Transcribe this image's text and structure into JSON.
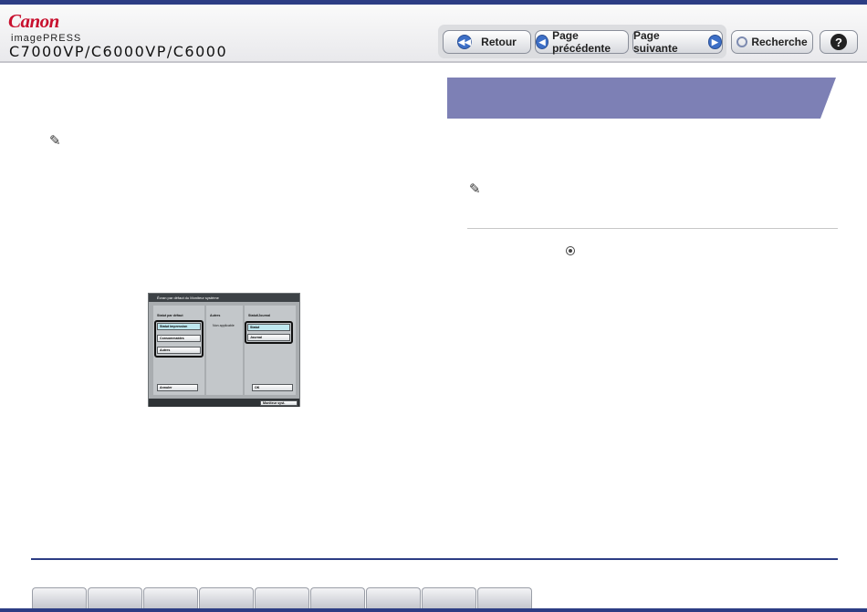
{
  "header": {
    "brand": "Canon",
    "sub_brand": "imagePRESS",
    "model": "C7000VP/C6000VP/C6000"
  },
  "nav": {
    "back_label": "Retour",
    "prev_label": "Page précédente",
    "next_label": "Page suivante",
    "search_label": "Recherche",
    "help_label": "?"
  },
  "screen": {
    "title": "Écran par défaut du Moniteur système",
    "col1_header": "Statut par défaut",
    "col1_buttons": [
      "Statut impression",
      "Consommables",
      "Autres"
    ],
    "col2_header": "Autres",
    "col2_value": "Non applicable",
    "col3_header": "Statut/Journal",
    "col3_buttons": [
      "Statut",
      "Journal"
    ],
    "cancel_label": "Annuler",
    "ok_label": "OK",
    "monitor_label": "Moniteur syst."
  },
  "icons": {
    "note": "pencil-icon",
    "back": "rewind-icon",
    "prev": "arrow-left-icon",
    "next": "arrow-right-icon",
    "search": "magnifier-icon",
    "help": "question-icon"
  },
  "colors": {
    "accent": "#2c3d84",
    "section_header": "#7d80b5",
    "brand_red": "#c8102e"
  },
  "tabs_count": 9
}
